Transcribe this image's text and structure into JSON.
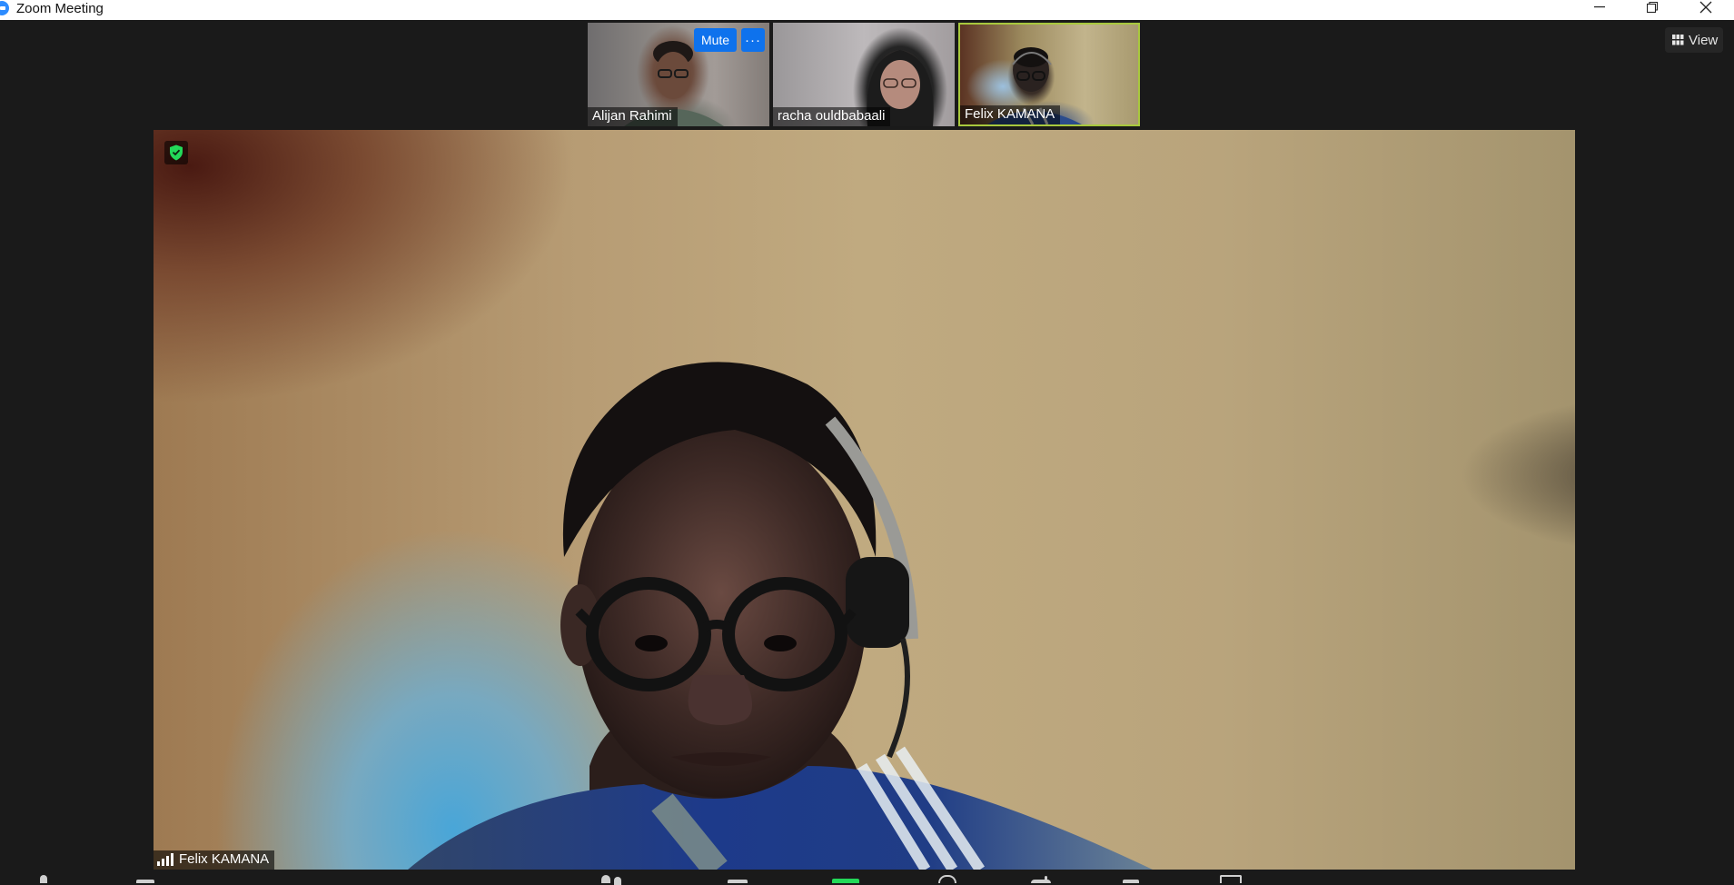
{
  "window": {
    "title": "Zoom Meeting",
    "controls": [
      "minimize-icon",
      "restore-icon",
      "close-icon"
    ]
  },
  "view_button": {
    "label": "View",
    "icon": "grid-icon"
  },
  "participants": [
    {
      "name": "Alijan Rahimi",
      "hover_controls": {
        "mute_label": "Mute",
        "more_label": "···"
      }
    },
    {
      "name": "racha ouldbabaali"
    },
    {
      "name": "Felix KAMANA",
      "active_speaker": true
    }
  ],
  "main_video": {
    "speaker_name": "Felix KAMANA",
    "security_icon": "shield-check-icon",
    "signal_icon": "connection-signal-icon"
  },
  "colors": {
    "accent_blue": "#0e72ed",
    "active_speaker_border": "#a8c83d",
    "security_green": "#23d959",
    "background": "#1a1a1a"
  }
}
